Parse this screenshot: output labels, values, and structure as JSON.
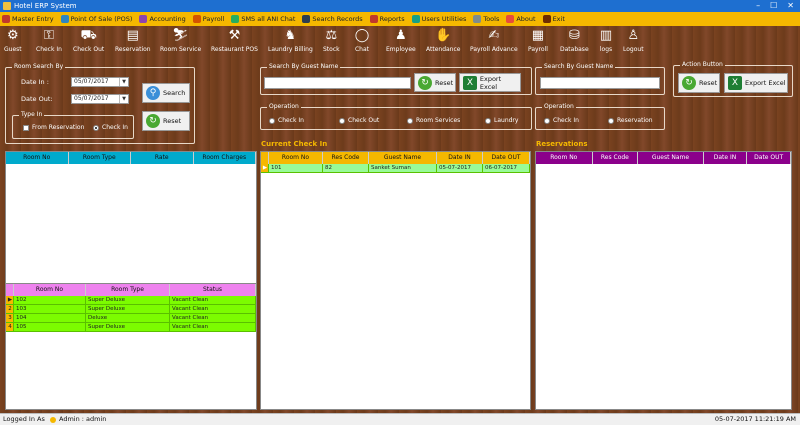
{
  "window": {
    "title": "Hotel ERP System",
    "min": "–",
    "max": "☐",
    "close": "✕"
  },
  "menu": [
    {
      "label": "Master Entry",
      "color": "#c0392b"
    },
    {
      "label": "Point Of Sale (POS)",
      "color": "#2e86c1"
    },
    {
      "label": "Accounting",
      "color": "#8e44ad"
    },
    {
      "label": "Payroll",
      "color": "#d35400"
    },
    {
      "label": "SMS all ANI Chat",
      "color": "#27ae60"
    },
    {
      "label": "Search Records",
      "color": "#2c3e50"
    },
    {
      "label": "Reports",
      "color": "#c0392b"
    },
    {
      "label": "Users Utilities",
      "color": "#16a085"
    },
    {
      "label": "Tools",
      "color": "#7f8c8d"
    },
    {
      "label": "About",
      "color": "#e74c3c"
    },
    {
      "label": "Exit",
      "color": "#6e2c00"
    }
  ],
  "toolbar": [
    {
      "label": "Guest",
      "icon": "guest-icon",
      "glyph": "⚙"
    },
    {
      "label": "Check In",
      "icon": "check-in-icon",
      "glyph": "⚿"
    },
    {
      "label": "Check Out",
      "icon": "check-out-icon",
      "glyph": "⛟"
    },
    {
      "label": "Reservation",
      "icon": "reservation-icon",
      "glyph": "▤"
    },
    {
      "label": "Room Service",
      "icon": "room-service-icon",
      "glyph": "⛷"
    },
    {
      "label": "Restaurant POS",
      "icon": "restaurant-icon",
      "glyph": "⚒"
    },
    {
      "label": "Laundry Billing",
      "icon": "laundry-icon",
      "glyph": "♞"
    },
    {
      "label": "Stock",
      "icon": "stock-icon",
      "glyph": "⚖"
    },
    {
      "label": "Chat",
      "icon": "chat-icon",
      "glyph": "◯"
    },
    {
      "label": "Employee",
      "icon": "employee-icon",
      "glyph": "♟"
    },
    {
      "label": "Attendance",
      "icon": "attendance-icon",
      "glyph": "✋"
    },
    {
      "label": "Payroll Advance",
      "icon": "payroll-advance-icon",
      "glyph": "✍"
    },
    {
      "label": "Payroll",
      "icon": "payroll-icon",
      "glyph": "▦"
    },
    {
      "label": "Database",
      "icon": "database-icon",
      "glyph": "⛁"
    },
    {
      "label": "logs",
      "icon": "logs-icon",
      "glyph": "▥"
    },
    {
      "label": "Logout",
      "icon": "logout-icon",
      "glyph": "♙"
    }
  ],
  "room_search": {
    "group_label": "Room Search By",
    "date_in_label": "Date In :",
    "date_in_value": "05/07/2017",
    "date_out_label": "Date Out:",
    "date_out_value": "05/07/2017",
    "type_label": "Type In",
    "option_reservation": "From Reservation",
    "option_checkin": "Check In",
    "search_btn": "Search",
    "reset_btn": "Reset"
  },
  "guest_search": {
    "group_label": "Search By Guest Name",
    "reset_btn": "Reset",
    "export_btn": "Export Excel"
  },
  "reservation_search": {
    "group_label": "Search By Guest Name"
  },
  "action_group": {
    "group_label": "Action Button",
    "reset_btn": "Reset",
    "export_btn": "Export Excel"
  },
  "operation1": {
    "group_label": "Operation",
    "options": [
      "Check In",
      "Check Out",
      "Room Services",
      "Laundry"
    ]
  },
  "operation2": {
    "group_label": "Operation",
    "options": [
      "Check In",
      "Reservation"
    ]
  },
  "available_rooms": {
    "columns": [
      "Room No",
      "Room Type",
      "Rate",
      "Room Charges"
    ]
  },
  "room_status": {
    "columns": [
      "Room No",
      "Room Type",
      "Status"
    ],
    "rows": [
      {
        "room": "102",
        "type": "Super Deluxe",
        "status": "Vacant Clean"
      },
      {
        "room": "103",
        "type": "Super Deluxe",
        "status": "Vacant Clean"
      },
      {
        "room": "104",
        "type": "Deluxe",
        "status": "Vacant Clean"
      },
      {
        "room": "105",
        "type": "Super Deluxe",
        "status": "Vacant Clean"
      }
    ]
  },
  "current_checkin": {
    "title": "Current Check In",
    "columns": [
      "Room No",
      "Res Code",
      "Guest Name",
      "Date IN",
      "Date OUT"
    ],
    "rows": [
      {
        "room": "101",
        "code": "82",
        "name": "Sanket Suman",
        "date_in": "05-07-2017",
        "date_out": "06-07-2017"
      }
    ]
  },
  "reservations": {
    "title": "Reservations",
    "columns": [
      "Room No",
      "Res Code",
      "Guest Name",
      "Date IN",
      "Date OUT"
    ]
  },
  "status": {
    "logged_label": "Logged In As",
    "user": "Admin : admin",
    "datetime": "05-07-2017 11:21:19 AM"
  }
}
